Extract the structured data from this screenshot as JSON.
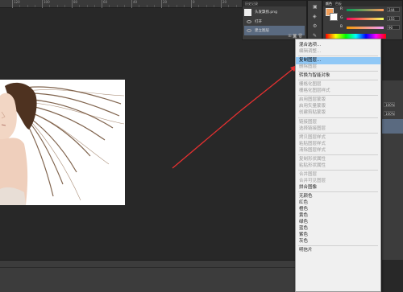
{
  "ruler": {
    "ticks": [
      "120",
      "100",
      "80",
      "60",
      "40",
      "20",
      "0",
      "20"
    ]
  },
  "history_panel": {
    "tab_label": "历史记录",
    "items": [
      {
        "label": "头发飘扬.png"
      },
      {
        "label": "打开"
      },
      {
        "label": "建立图层"
      }
    ]
  },
  "color_panel": {
    "tabs": [
      "颜色",
      "色板"
    ],
    "channels": [
      {
        "label": "R",
        "value": "244",
        "color": "#f4a05a"
      },
      {
        "label": "G",
        "value": "155",
        "color": "#f4a05a"
      },
      {
        "label": "B",
        "value": "90",
        "color": "#f4a05a"
      }
    ]
  },
  "context_menu": {
    "items": [
      {
        "label": "混合选项...",
        "state": "normal"
      },
      {
        "label": "编辑调整...",
        "state": "disabled"
      },
      {
        "sep": true
      },
      {
        "label": "复制图层...",
        "state": "highlight"
      },
      {
        "label": "删除图层",
        "state": "disabled"
      },
      {
        "sep": true
      },
      {
        "label": "转换为智能对象",
        "state": "normal"
      },
      {
        "sep": true
      },
      {
        "label": "栅格化图层",
        "state": "disabled"
      },
      {
        "label": "栅格化图层样式",
        "state": "disabled"
      },
      {
        "sep": true
      },
      {
        "label": "启用图层蒙版",
        "state": "disabled"
      },
      {
        "label": "启用矢量蒙版",
        "state": "disabled"
      },
      {
        "label": "创建剪贴蒙版",
        "state": "disabled"
      },
      {
        "sep": true
      },
      {
        "label": "链接图层",
        "state": "disabled"
      },
      {
        "label": "选择链接图层",
        "state": "disabled"
      },
      {
        "sep": true
      },
      {
        "label": "拷贝图层样式",
        "state": "disabled"
      },
      {
        "label": "粘贴图层样式",
        "state": "disabled"
      },
      {
        "label": "清除图层样式",
        "state": "disabled"
      },
      {
        "sep": true
      },
      {
        "label": "复制形状属性",
        "state": "disabled"
      },
      {
        "label": "粘贴形状属性",
        "state": "disabled"
      },
      {
        "sep": true
      },
      {
        "label": "合并图层",
        "state": "disabled"
      },
      {
        "label": "合并可见图层",
        "state": "disabled"
      },
      {
        "label": "拼合图像",
        "state": "normal"
      },
      {
        "sep": true
      },
      {
        "label": "无颜色",
        "state": "normal"
      },
      {
        "label": "红色",
        "state": "normal"
      },
      {
        "label": "橙色",
        "state": "normal"
      },
      {
        "label": "黄色",
        "state": "normal"
      },
      {
        "label": "绿色",
        "state": "normal"
      },
      {
        "label": "蓝色",
        "state": "normal"
      },
      {
        "label": "紫色",
        "state": "normal"
      },
      {
        "label": "灰色",
        "state": "normal"
      },
      {
        "sep": true
      },
      {
        "label": "明信片",
        "state": "normal"
      }
    ]
  },
  "right_strip": {
    "opacity": "100%",
    "fill": "100%"
  }
}
